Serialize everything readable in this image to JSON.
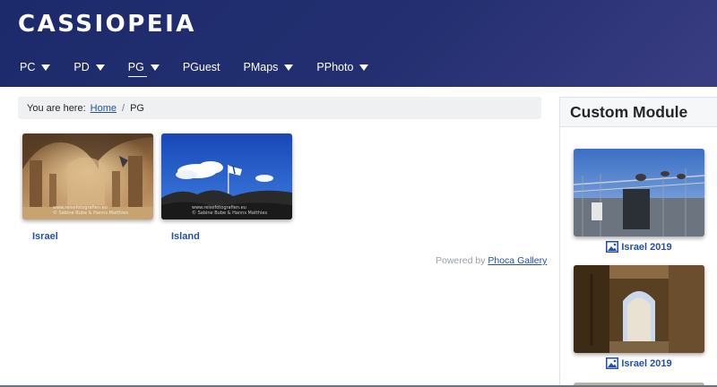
{
  "site": {
    "brand": "CASSIOPEIA"
  },
  "nav": {
    "items": [
      {
        "label": "PC",
        "dropdown": true
      },
      {
        "label": "PD",
        "dropdown": true
      },
      {
        "label": "PG",
        "dropdown": true,
        "active": true
      },
      {
        "label": "PGuest",
        "dropdown": false
      },
      {
        "label": "PMaps",
        "dropdown": true
      },
      {
        "label": "PPhoto",
        "dropdown": true
      }
    ]
  },
  "breadcrumb": {
    "prefix": "You are here:",
    "home": "Home",
    "separator": "/",
    "current": "PG"
  },
  "gallery": {
    "items": [
      {
        "caption": "Israel",
        "watermark_1": "www.reisefotografien.eu",
        "watermark_2": "© Sabine Bube & Hanns Matthies"
      },
      {
        "caption": "Island",
        "watermark_1": "www.reisefotografien.eu",
        "watermark_2": "© Sabine Bube & Hanns Matthies"
      }
    ],
    "powered_by_prefix": "Powered by",
    "powered_by_link": "Phoca Gallery"
  },
  "sidebar": {
    "title": "Custom Module",
    "items": [
      {
        "caption": "Israel 2019"
      },
      {
        "caption": "Israel 2019"
      }
    ]
  },
  "colors": {
    "header_start": "#1c2a6b",
    "header_end": "#3a3d82",
    "link": "#224faa"
  }
}
